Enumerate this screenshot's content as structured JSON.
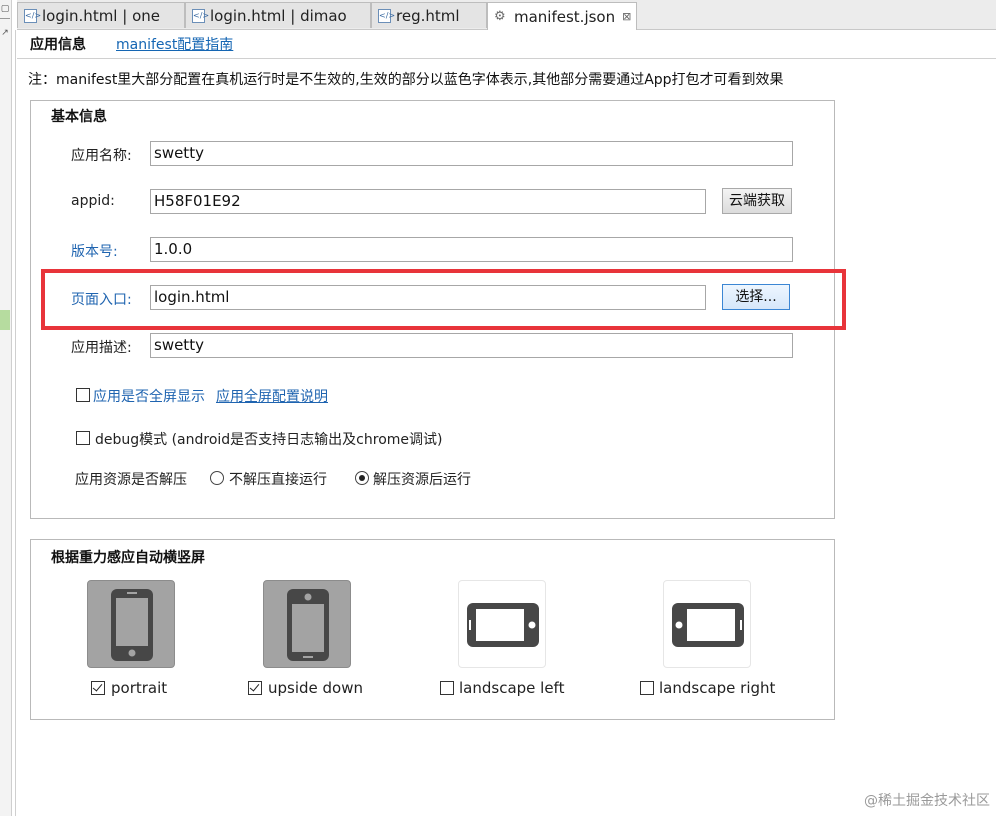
{
  "tabs": [
    {
      "label": "login.html | one",
      "icon": "html-file-icon"
    },
    {
      "label": "login.html | dimao",
      "icon": "html-file-icon"
    },
    {
      "label": "reg.html",
      "icon": "html-file-icon"
    },
    {
      "label": "manifest.json",
      "icon": "settings-file-icon",
      "close": "⊠"
    }
  ],
  "subheader": {
    "title": "应用信息",
    "link": "manifest配置指南"
  },
  "note": "注：manifest里大部分配置在真机运行时是不生效的,生效的部分以蓝色字体表示,其他部分需要通过App打包才可看到效果",
  "basic": {
    "title": "基本信息",
    "app_name_label": "应用名称:",
    "app_name": "swetty",
    "appid_label": "appid:",
    "appid": "H58F01E92",
    "cloud_button": "云端获取",
    "version_label": "版本号:",
    "version": "1.0.0",
    "entry_label": "页面入口:",
    "entry": "login.html",
    "choose_button": "选择...",
    "desc_label": "应用描述:",
    "desc": "swetty",
    "fullscreen_label": "应用是否全屏显示",
    "fullscreen_link": "应用全屏配置说明",
    "debug_label": "debug模式 (android是否支持日志输出及chrome调试)",
    "unzip_label": "应用资源是否解压",
    "unzip_options": [
      "不解压直接运行",
      "解压资源后运行"
    ],
    "unzip_selected": "解压资源后运行"
  },
  "gravity": {
    "title": "根据重力感应自动横竖屏",
    "options": [
      {
        "label": "portrait",
        "checked": true
      },
      {
        "label": "upside down",
        "checked": true
      },
      {
        "label": "landscape left",
        "checked": false
      },
      {
        "label": "landscape right",
        "checked": false
      }
    ]
  },
  "watermark": "@稀土掘金技术社区",
  "colors": {
    "accent_blue": "#1f64b0",
    "highlight_red": "#e8343a",
    "selected_tile": "#a3a3a3"
  }
}
